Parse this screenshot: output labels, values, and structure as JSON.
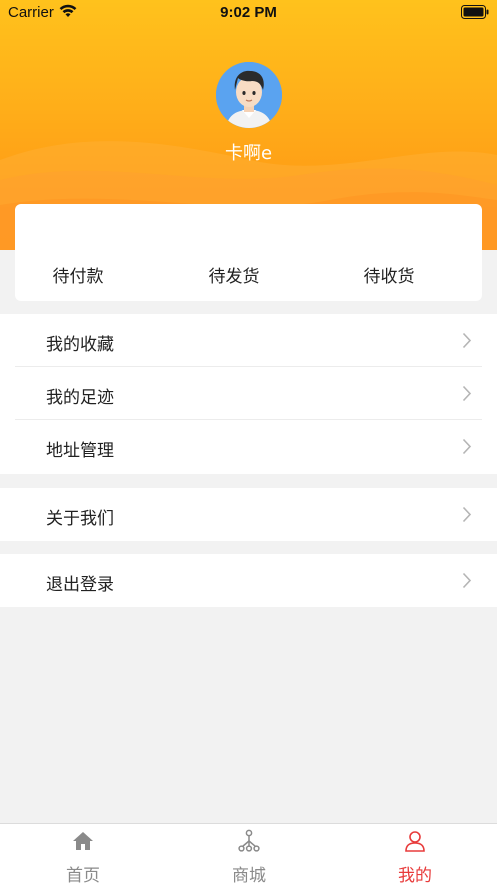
{
  "status_bar": {
    "carrier": "Carrier",
    "time": "9:02 PM"
  },
  "profile": {
    "username": "卡啊e"
  },
  "orders": {
    "items": [
      {
        "label": "待付款"
      },
      {
        "label": "待发货"
      },
      {
        "label": "待收货"
      }
    ]
  },
  "menu": {
    "group1": [
      {
        "label": "我的收藏"
      },
      {
        "label": "我的足迹"
      },
      {
        "label": "地址管理"
      }
    ],
    "group2": [
      {
        "label": "关于我们"
      }
    ],
    "group3": [
      {
        "label": "退出登录"
      }
    ]
  },
  "tab_bar": {
    "tabs": [
      {
        "label": "首页",
        "icon": "home-icon"
      },
      {
        "label": "商城",
        "icon": "shop-icon"
      },
      {
        "label": "我的",
        "icon": "user-icon"
      }
    ],
    "active_index": 2
  },
  "colors": {
    "header_top": "#ffc21c",
    "header_bottom": "#ff8f12",
    "active_tab": "#e83b3b",
    "inactive_tab": "#8a8a8a",
    "background": "#f2f2f2"
  }
}
